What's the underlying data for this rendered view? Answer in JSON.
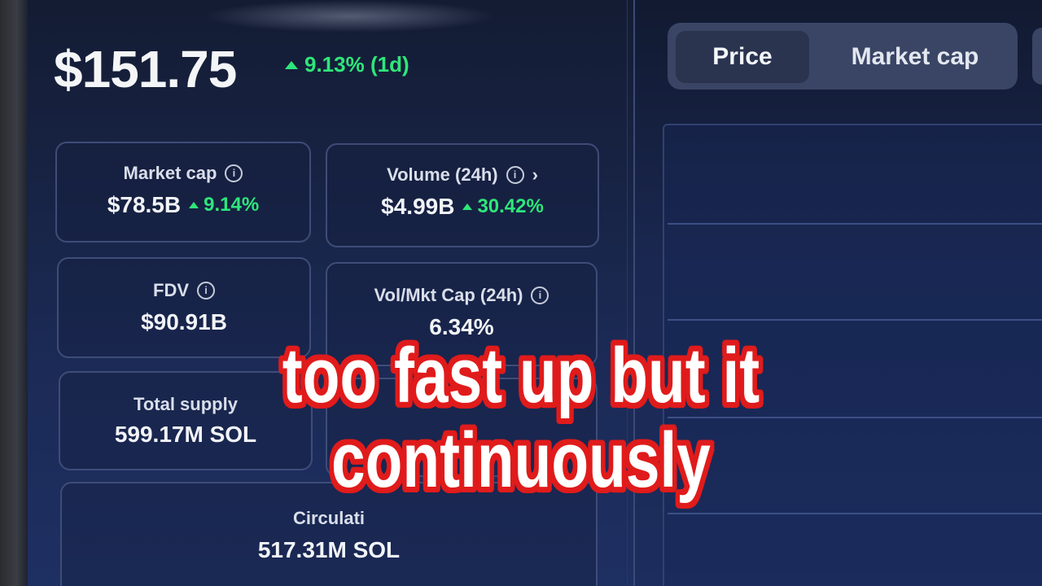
{
  "price": {
    "value": "$151.75",
    "change": "9.13% (1d)",
    "direction": "up",
    "up_color": "#2ee67a"
  },
  "stats": {
    "market_cap": {
      "label": "Market cap",
      "value": "$78.5B",
      "change": "9.14%"
    },
    "volume": {
      "label": "Volume (24h)",
      "value": "$4.99B",
      "change": "30.42%"
    },
    "fdv": {
      "label": "FDV",
      "value": "$90.91B"
    },
    "vol_mkt_cap": {
      "label": "Vol/Mkt Cap (24h)",
      "value": "6.34%"
    },
    "total_supply": {
      "label": "Total supply",
      "value": "599.17M SOL"
    },
    "circulating": {
      "label": "Circulati",
      "value": "517.31M SOL"
    }
  },
  "chart_tabs": [
    {
      "label": "Price",
      "selected": true
    },
    {
      "label": "Market cap",
      "selected": false
    }
  ],
  "caption": {
    "line1": "too fast up but it",
    "line2": "continuously",
    "outline_color": "#e01b1b"
  },
  "icons": {
    "info": "info-icon",
    "chevron": "chevron-right-icon",
    "up": "triangle-up-icon"
  }
}
